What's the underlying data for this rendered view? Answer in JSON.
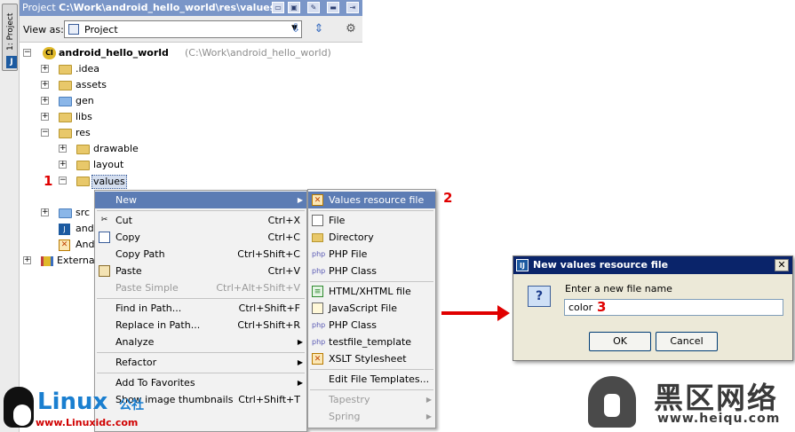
{
  "toolstrip": {
    "tab_label": "1: Project"
  },
  "titlebar": {
    "prefix": "Project ",
    "path": "C:\\Work\\android_hello_world\\res\\values"
  },
  "viewbar": {
    "label": "View as:",
    "selected": "Project",
    "icons": [
      "scroll-from-source-icon",
      "collapse-all-icon",
      "settings-icon"
    ]
  },
  "tree": {
    "root": {
      "name": "android_hello_world",
      "path": "(C:\\Work\\android_hello_world)"
    },
    "items": [
      {
        "label": ".idea"
      },
      {
        "label": "assets"
      },
      {
        "label": "gen"
      },
      {
        "label": "libs"
      },
      {
        "label": "res"
      },
      {
        "label": "drawable"
      },
      {
        "label": "layout"
      },
      {
        "label": "values"
      },
      {
        "label": "src"
      },
      {
        "label": "andr"
      },
      {
        "label": "Andr"
      },
      {
        "label": "External"
      }
    ]
  },
  "markers": {
    "m1": "1",
    "m2": "2",
    "m3": "3"
  },
  "context_menu": {
    "items": [
      {
        "label": "New",
        "shortcut": ""
      },
      {
        "label": "Cut",
        "shortcut": "Ctrl+X"
      },
      {
        "label": "Copy",
        "shortcut": "Ctrl+C"
      },
      {
        "label": "Copy Path",
        "shortcut": "Ctrl+Shift+C"
      },
      {
        "label": "Paste",
        "shortcut": "Ctrl+V"
      },
      {
        "label": "Paste Simple",
        "shortcut": "Ctrl+Alt+Shift+V"
      },
      {
        "label": "Find in Path...",
        "shortcut": "Ctrl+Shift+F"
      },
      {
        "label": "Replace in Path...",
        "shortcut": "Ctrl+Shift+R"
      },
      {
        "label": "Analyze",
        "shortcut": ""
      },
      {
        "label": "Refactor",
        "shortcut": ""
      },
      {
        "label": "Add To Favorites",
        "shortcut": ""
      },
      {
        "label": "Show image thumbnails",
        "shortcut": "Ctrl+Shift+T"
      }
    ]
  },
  "submenu": {
    "items": [
      {
        "label": "Values resource file"
      },
      {
        "label": "File"
      },
      {
        "label": "Directory"
      },
      {
        "label": "PHP File"
      },
      {
        "label": "PHP Class"
      },
      {
        "label": "HTML/XHTML file"
      },
      {
        "label": "JavaScript File"
      },
      {
        "label": "PHP Class"
      },
      {
        "label": "testfile_template"
      },
      {
        "label": "XSLT Stylesheet"
      },
      {
        "label": "Edit File Templates..."
      },
      {
        "label": "Tapestry"
      },
      {
        "label": "Spring"
      }
    ]
  },
  "dialog": {
    "title": "New values resource file",
    "prompt": "Enter a new file name",
    "value": "color",
    "ok": "OK",
    "cancel": "Cancel"
  },
  "watermarks": {
    "linux": "Linux",
    "gongshe": "公社",
    "linux_url": "www.Linuxidc.com",
    "heiqu": "黑区网络",
    "heiqu_url": "www.heiqu.com"
  },
  "colors": {
    "selection": "#5c7cb4",
    "titlebar": "#7a96c8",
    "dialog_title": "#0a246a",
    "annotation_red": "#e00000"
  }
}
